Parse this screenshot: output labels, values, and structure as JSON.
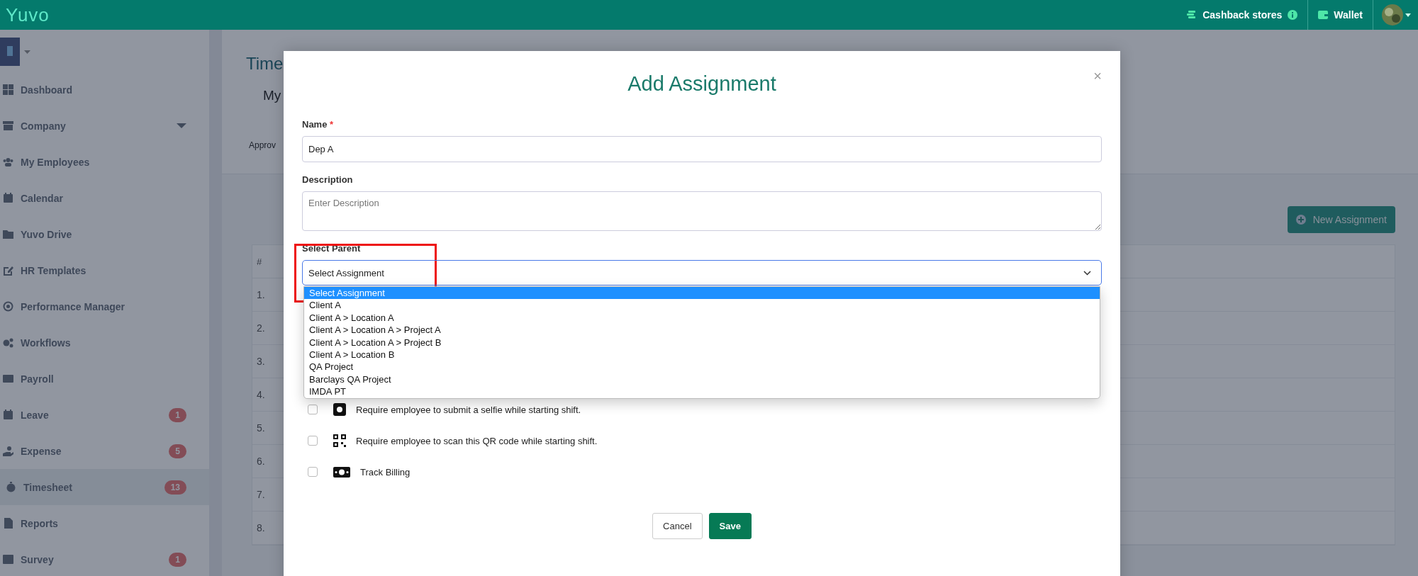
{
  "top_bar": {
    "logo": "Yuvo",
    "links": [
      {
        "label": "Cashback stores",
        "kind": "cashback"
      },
      {
        "label": "Wallet",
        "kind": "wallet"
      }
    ]
  },
  "sidebar": {
    "items": [
      {
        "label": "Dashboard",
        "kind": "link",
        "selected": false
      },
      {
        "label": "Company",
        "kind": "group",
        "selected": false
      },
      {
        "label": "My Employees",
        "kind": "link",
        "selected": false
      },
      {
        "label": "Calendar",
        "kind": "link",
        "selected": false
      },
      {
        "label": "Yuvo Drive",
        "kind": "link",
        "selected": false
      },
      {
        "label": "HR Templates",
        "kind": "link",
        "selected": false
      },
      {
        "label": "Performance Manager",
        "kind": "link",
        "selected": false
      },
      {
        "label": "Workflows",
        "kind": "link",
        "selected": false
      },
      {
        "label": "Payroll",
        "kind": "link",
        "selected": false
      },
      {
        "label": "Leave",
        "kind": "link",
        "selected": false,
        "badge": "1"
      },
      {
        "label": "Expense",
        "kind": "link",
        "selected": false,
        "badge": "5"
      },
      {
        "label": "Timesheet",
        "kind": "link",
        "selected": true,
        "badge": "13"
      },
      {
        "label": "Reports",
        "kind": "link",
        "selected": false
      },
      {
        "label": "Survey",
        "kind": "link",
        "selected": false,
        "badge": "1"
      }
    ]
  },
  "main": {
    "title": "Time",
    "tab": "My",
    "subtab": "Approv",
    "new_button": "New Assignment",
    "table": {
      "columns": [
        "#"
      ],
      "rows": [
        "1.",
        "2.",
        "3.",
        "4.",
        "5.",
        "6.",
        "7.",
        "8."
      ]
    }
  },
  "modal": {
    "title": "Add Assignment",
    "close": "×",
    "name_field": {
      "label": "Name",
      "required_mark": "*",
      "value": "Dep A"
    },
    "description_field": {
      "label": "Description",
      "placeholder": "Enter Description"
    },
    "parent_select": {
      "label": "Select Parent",
      "value": "Select Assignment",
      "highlighted": true,
      "options": [
        {
          "label": "Select Assignment",
          "selected": true
        },
        {
          "label": "Client A",
          "selected": false
        },
        {
          "label": "Client A > Location A",
          "selected": false
        },
        {
          "label": "Client A > Location A > Project A",
          "selected": false
        },
        {
          "label": "Client A > Location A > Project B",
          "selected": false
        },
        {
          "label": "Client A > Location B",
          "selected": false
        },
        {
          "label": "QA Project",
          "selected": false
        },
        {
          "label": "Barclays QA Project",
          "selected": false
        },
        {
          "label": "IMDA PT",
          "selected": false
        }
      ]
    },
    "checks": [
      {
        "label": "Require employee to submit a selfie while starting shift.",
        "checked": false,
        "kind": "selfie"
      },
      {
        "label": "Require employee to scan this QR code while starting shift.",
        "checked": false,
        "kind": "qr"
      },
      {
        "label": "Track Billing",
        "checked": false,
        "kind": "billing"
      }
    ],
    "buttons": [
      {
        "label": "Cancel",
        "kind": "secondary"
      },
      {
        "label": "Save",
        "kind": "primary"
      }
    ]
  }
}
